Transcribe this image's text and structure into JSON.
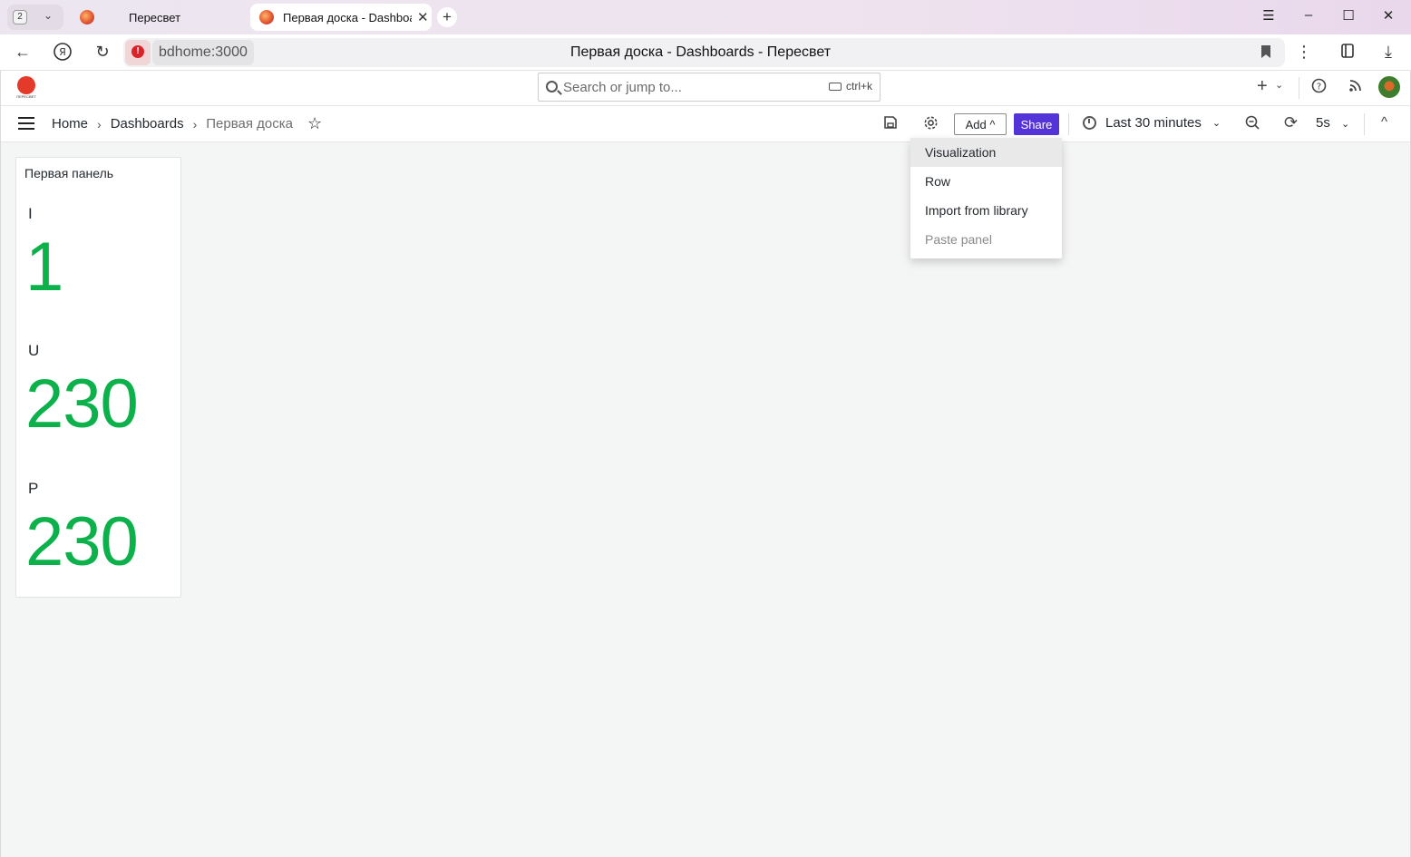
{
  "browser": {
    "tab_count": "2",
    "tabs": [
      {
        "label": "Пересвет"
      },
      {
        "label": "Первая доска - Dashboards - Пересвет"
      }
    ],
    "url_host": "bdhome:3000",
    "page_title": "Первая доска - Dashboards - Пересвет"
  },
  "topbar": {
    "logo_text": "ПЕРЕСВЕТ",
    "search_placeholder": "Search or jump to...",
    "search_shortcut": "ctrl+k"
  },
  "toolbar": {
    "breadcrumbs": [
      "Home",
      "Dashboards",
      "Первая доска"
    ],
    "add_label": "Add",
    "share_label": "Share",
    "time_range": "Last 30 minutes",
    "refresh_interval": "5s"
  },
  "add_menu": {
    "items": [
      "Visualization",
      "Row",
      "Import from library",
      "Paste panel"
    ]
  },
  "panel": {
    "title": "Первая панель",
    "stats": [
      {
        "label": "I",
        "value": "1"
      },
      {
        "label": "U",
        "value": "230"
      },
      {
        "label": "P",
        "value": "230"
      }
    ]
  },
  "colors": {
    "accent": "#5433d8",
    "stat_value": "#0db14b"
  }
}
